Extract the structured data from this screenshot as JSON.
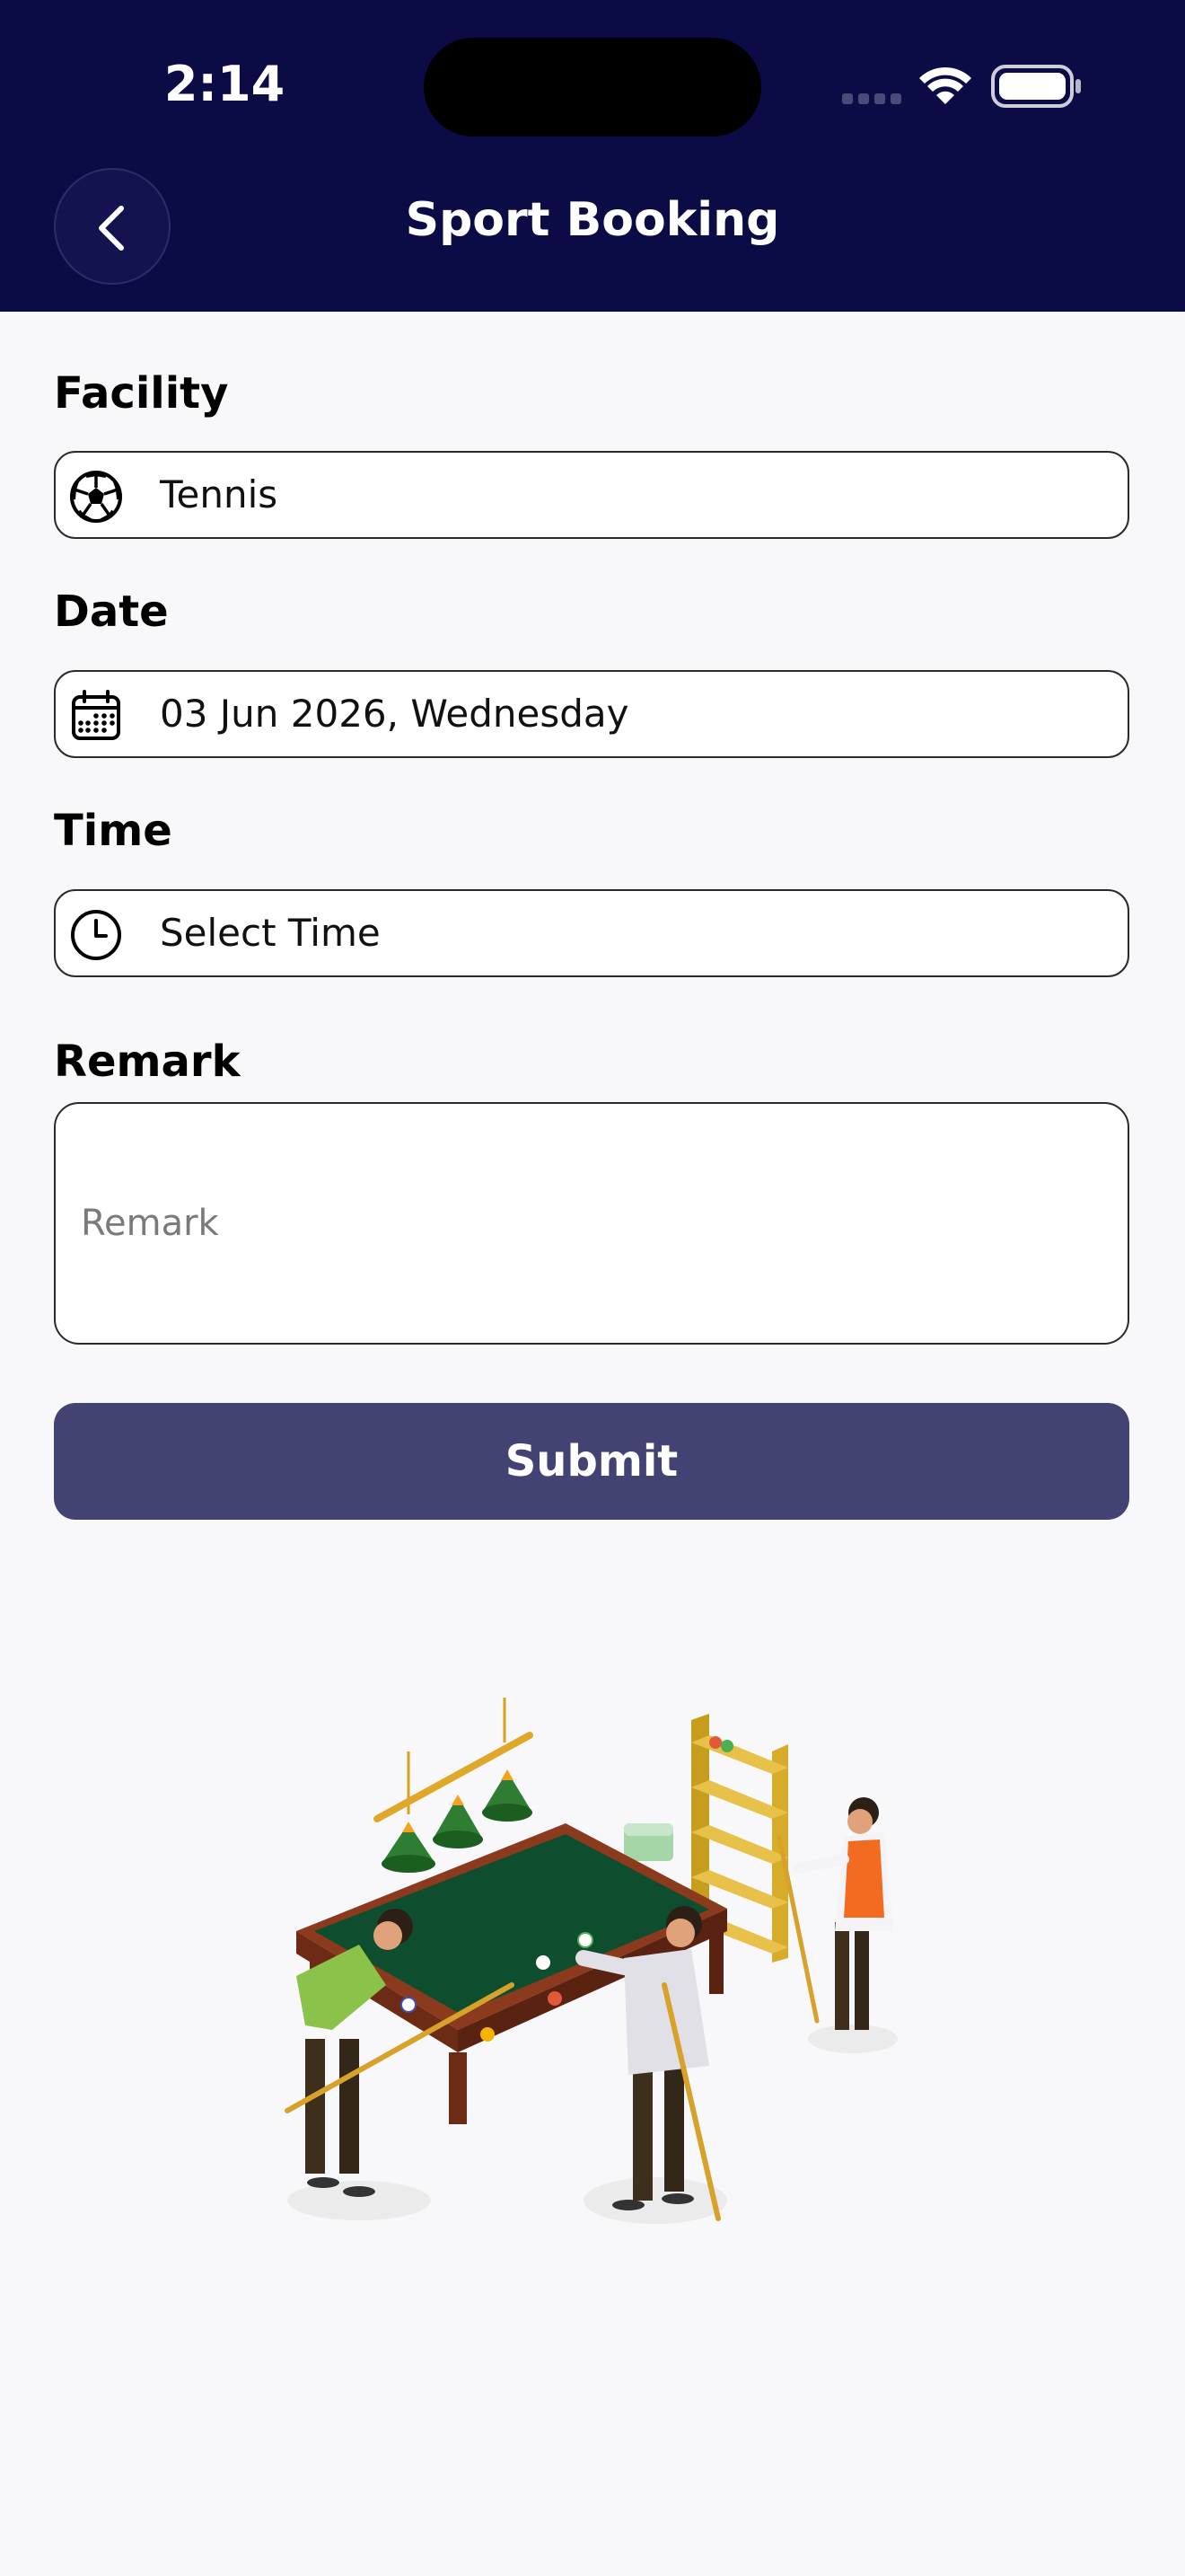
{
  "status_bar": {
    "time": "2:14"
  },
  "header": {
    "title": "Sport Booking"
  },
  "form": {
    "facility": {
      "label": "Facility",
      "value": "Tennis",
      "icon": "soccer-ball-icon"
    },
    "date": {
      "label": "Date",
      "value": "03 Jun 2026, Wednesday",
      "icon": "calendar-icon"
    },
    "time": {
      "label": "Time",
      "value": "Select Time",
      "icon": "clock-icon"
    },
    "remark": {
      "label": "Remark",
      "placeholder": "Remark",
      "value": ""
    },
    "submit_label": "Submit"
  },
  "colors": {
    "header_bg": "#0b0b45",
    "submit_bg": "#434373",
    "page_bg": "#f8f8fa"
  }
}
